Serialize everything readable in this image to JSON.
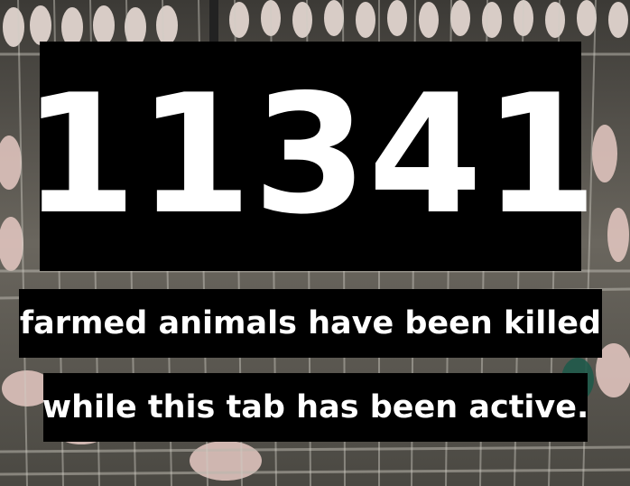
{
  "counter": {
    "value": "11341"
  },
  "caption": {
    "line1": "farmed animals have been killed",
    "line2": "while this tab has been active."
  },
  "colors": {
    "box_background": "#000000",
    "text": "#ffffff"
  }
}
